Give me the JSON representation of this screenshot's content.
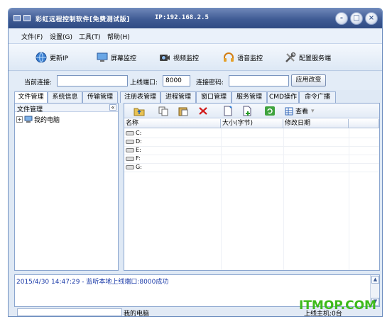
{
  "window": {
    "title": "彩虹远程控制软件[免费测试版]",
    "ip_label": "IP:192.168.2.5",
    "buttons": {
      "minimize": "-",
      "maximize": "□",
      "close": "×"
    }
  },
  "menu": [
    "文件(F)",
    "设置(G)",
    "工具(T)",
    "帮助(H)"
  ],
  "toolbar": [
    {
      "label": "更新IP",
      "icon": "globe-icon"
    },
    {
      "label": "屏幕监控",
      "icon": "monitor-icon"
    },
    {
      "label": "视频监控",
      "icon": "camera-icon"
    },
    {
      "label": "语音监控",
      "icon": "headset-icon"
    },
    {
      "label": "配置服务端",
      "icon": "tools-icon"
    }
  ],
  "connection": {
    "current_label": "当前连接:",
    "current_value": "",
    "port_label": "上线端口:",
    "port_value": "8000",
    "password_label": "连接密码:",
    "password_value": "",
    "apply_label": "应用改变"
  },
  "tabs": [
    "文件管理",
    "系统信息",
    "传输管理",
    "注册表管理",
    "进程管理",
    "窗口管理",
    "服务管理",
    "CMD操作",
    "命令广播"
  ],
  "left_panel": {
    "title": "文件管理",
    "collapse": "«",
    "tree_root": "我的电脑"
  },
  "right_panel": {
    "view_label": "查看",
    "columns": [
      "名称",
      "大小(字节)",
      "修改日期"
    ],
    "files": [
      "C:",
      "D:",
      "E:",
      "F:",
      "G:"
    ]
  },
  "log": {
    "entry": "2015/4/30 14:47:29 - 监听本地上线端口:8000成功"
  },
  "status": {
    "computer": "我的电脑",
    "right_text": "上线主机:0台"
  },
  "watermark": "ITMOP.COM",
  "colors": {
    "title_bar": "#3f5b94",
    "log_text": "#1a3aa8",
    "watermark": "#3dba1b"
  }
}
